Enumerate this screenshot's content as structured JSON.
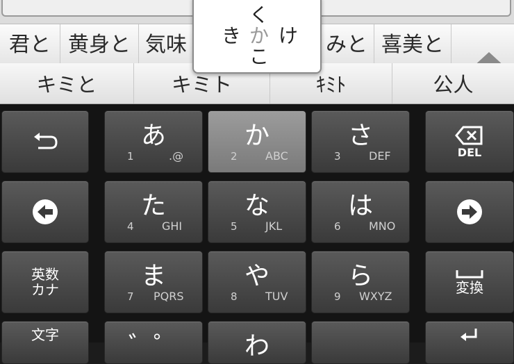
{
  "candidates_row1": [
    "君と",
    "黄身と",
    "気味",
    "みと",
    "喜美と"
  ],
  "candidates_row2": [
    "キミと",
    "キミト",
    "ｷﾐﾄ",
    "公人"
  ],
  "popup": {
    "top": "く",
    "left": "き",
    "center": "か",
    "right": "け",
    "bottom": "こ"
  },
  "keys": {
    "a": {
      "main": "あ",
      "num": "1",
      "sub": ".@"
    },
    "ka": {
      "main": "か",
      "num": "2",
      "sub": "ABC"
    },
    "sa": {
      "main": "さ",
      "num": "3",
      "sub": "DEF"
    },
    "ta": {
      "main": "た",
      "num": "4",
      "sub": "GHI"
    },
    "na": {
      "main": "な",
      "num": "5",
      "sub": "JKL"
    },
    "ha": {
      "main": "は",
      "num": "6",
      "sub": "MNO"
    },
    "ma": {
      "main": "ま",
      "num": "7",
      "sub": "PQRS"
    },
    "ya": {
      "main": "や",
      "num": "8",
      "sub": "TUV"
    },
    "ra": {
      "main": "ら",
      "num": "9",
      "sub": "WXYZ"
    },
    "dakuten": {
      "main": "゛゜"
    },
    "wa": {
      "main": "わ"
    }
  },
  "function_keys": {
    "del_label": "DEL",
    "eisu_kana_line1": "英数",
    "eisu_kana_line2": "カナ",
    "henkan_label": "変換",
    "moji_label": "文字"
  },
  "icons": [
    "undo-icon",
    "left-arrow-icon",
    "right-arrow-icon",
    "backspace-icon",
    "space-icon",
    "up-arrow-icon",
    "enter-icon"
  ],
  "colors": {
    "key_bg": "#4a4a4a",
    "active_key": "#8c8c8c",
    "candidate_bg": "#f0f0f0"
  }
}
